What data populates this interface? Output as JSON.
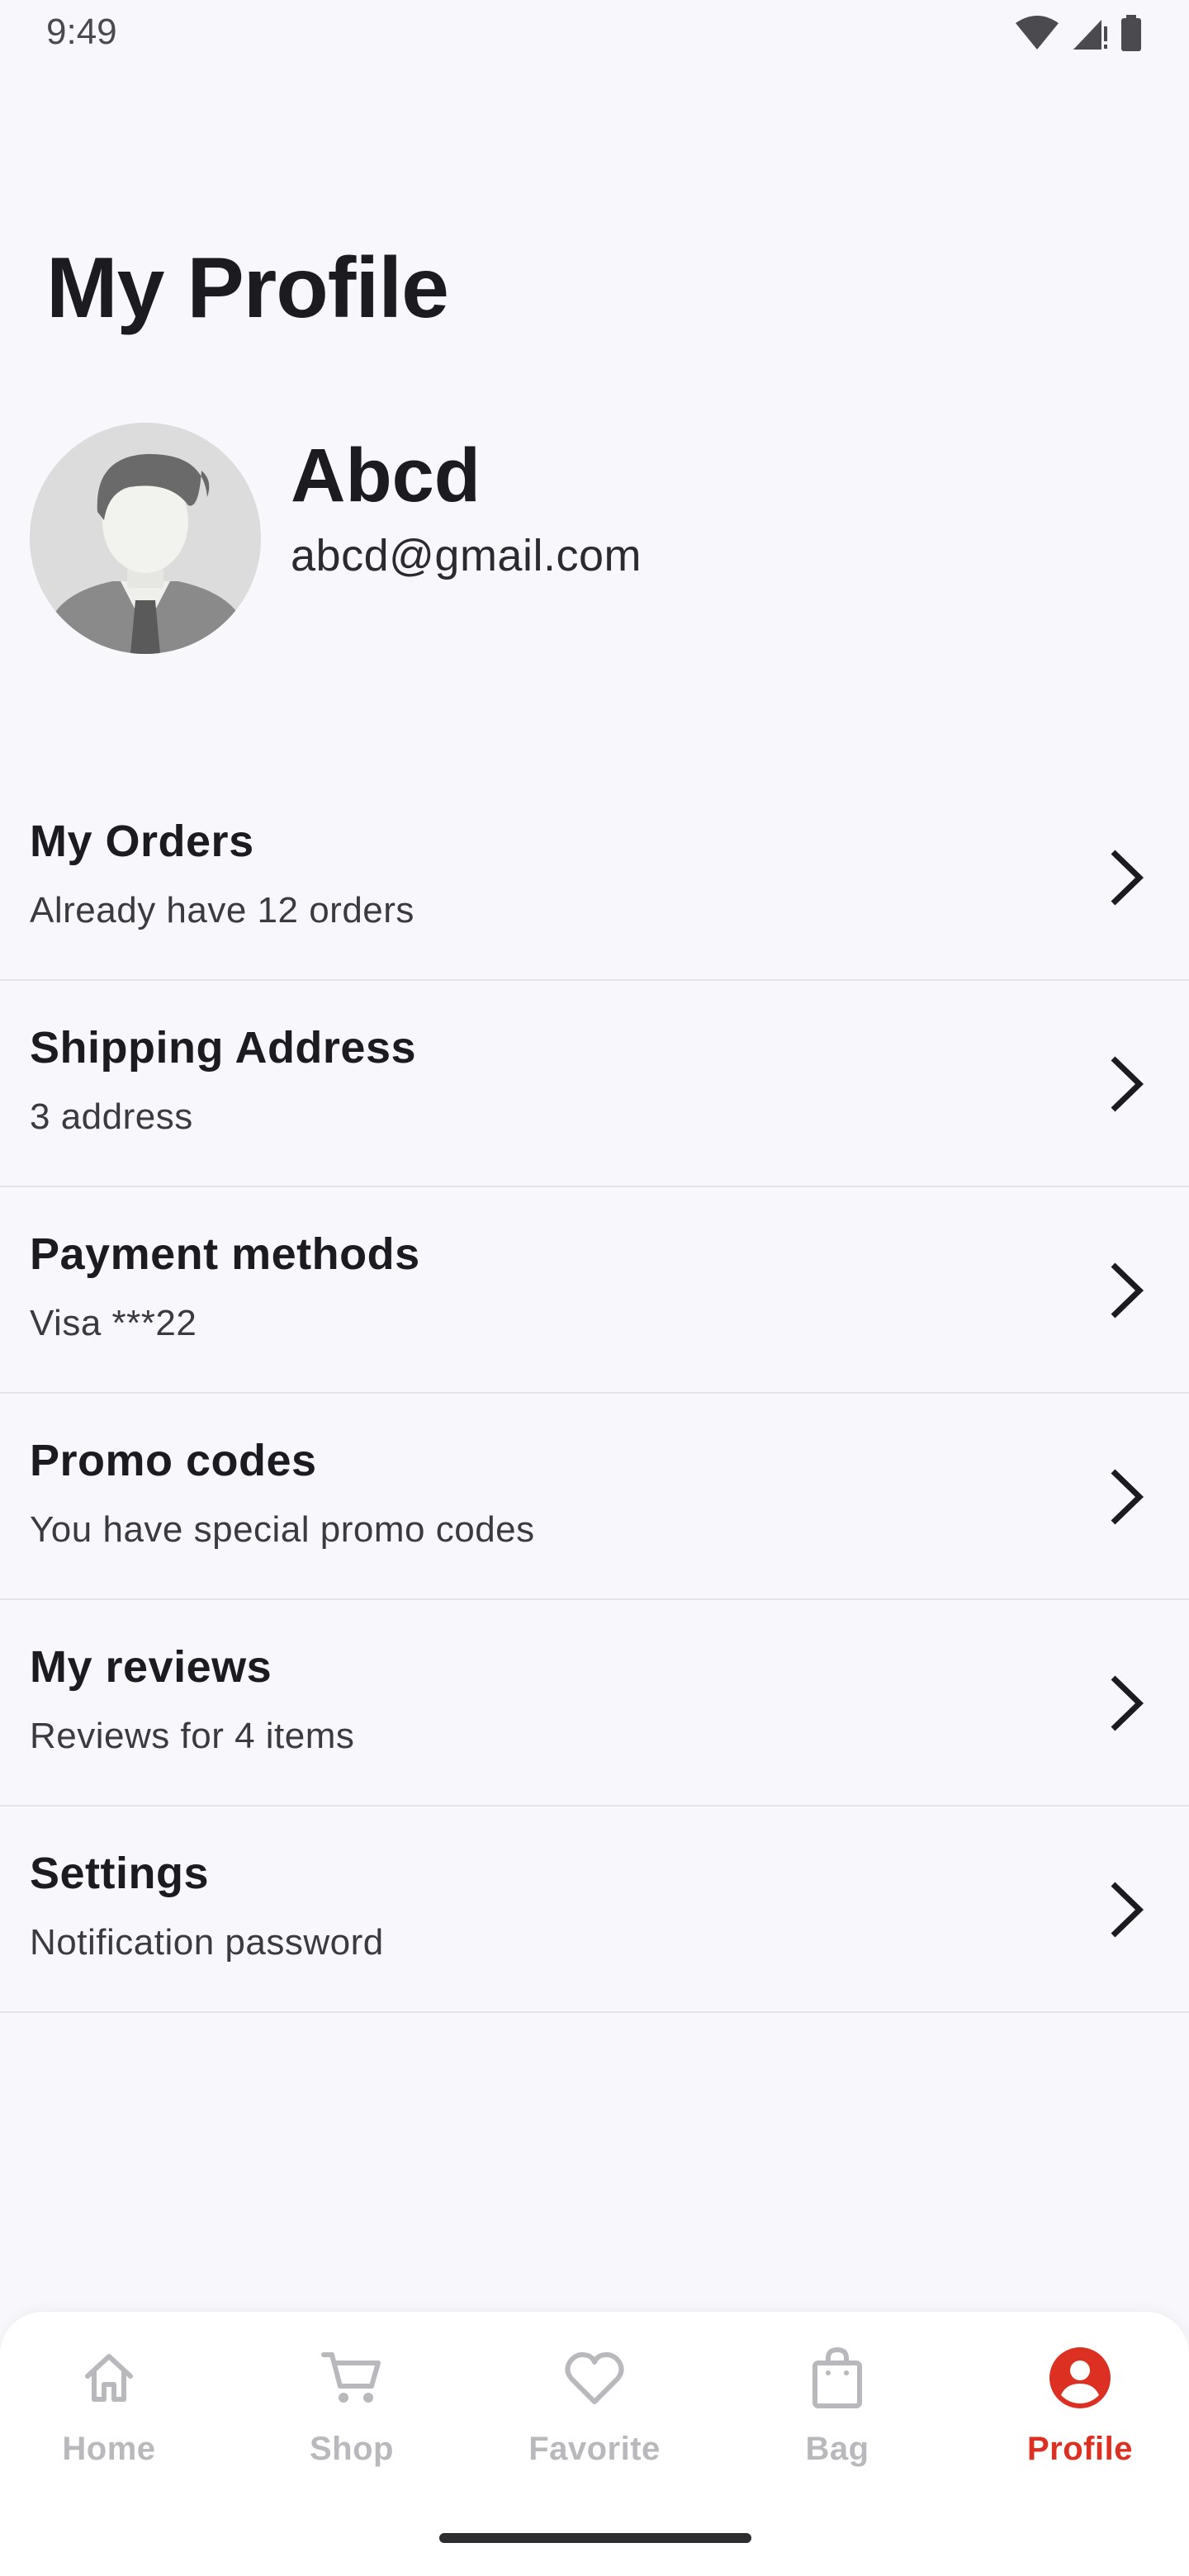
{
  "status_bar": {
    "time": "9:49"
  },
  "page": {
    "title": "My Profile"
  },
  "profile": {
    "name": "Abcd",
    "email": "abcd@gmail.com"
  },
  "menu": [
    {
      "title": "My Orders",
      "subtitle": "Already have 12 orders"
    },
    {
      "title": "Shipping Address",
      "subtitle": "3 address"
    },
    {
      "title": "Payment methods",
      "subtitle": "Visa ***22"
    },
    {
      "title": "Promo codes",
      "subtitle": "You have special promo codes"
    },
    {
      "title": "My reviews",
      "subtitle": "Reviews for 4 items"
    },
    {
      "title": "Settings",
      "subtitle": "Notification password"
    }
  ],
  "bottom_nav": {
    "items": [
      {
        "label": "Home",
        "icon": "home-icon",
        "active": false
      },
      {
        "label": "Shop",
        "icon": "cart-icon",
        "active": false
      },
      {
        "label": "Favorite",
        "icon": "heart-icon",
        "active": false
      },
      {
        "label": "Bag",
        "icon": "bag-icon",
        "active": false
      },
      {
        "label": "Profile",
        "icon": "profile-icon",
        "active": true
      }
    ]
  },
  "colors": {
    "accent": "#db3022",
    "inactive": "#b9b9bd",
    "background": "#f8f7fc"
  }
}
